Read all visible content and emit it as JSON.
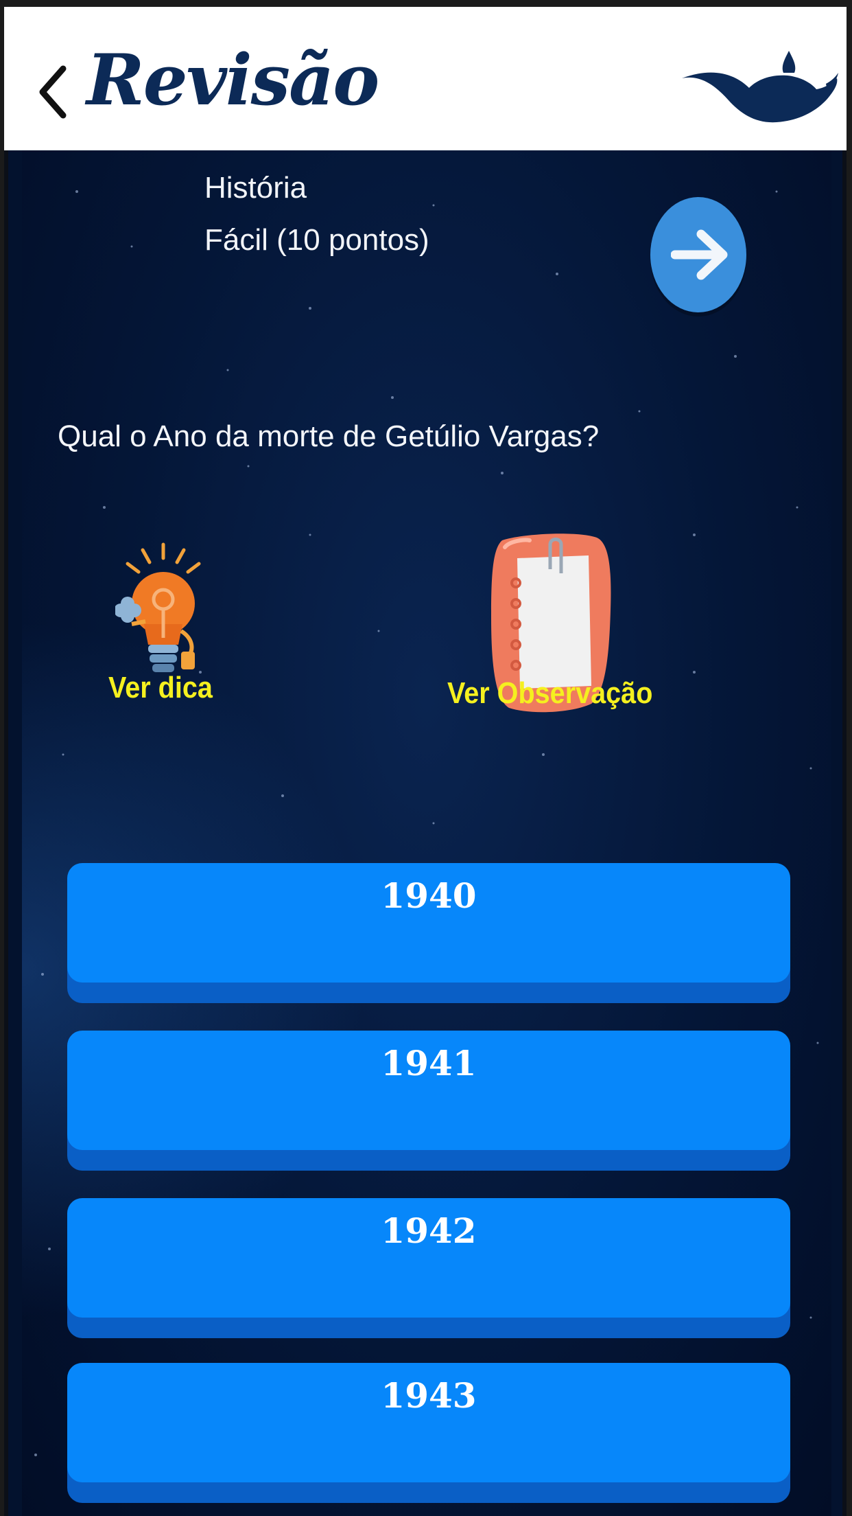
{
  "header": {
    "title": "Revisão",
    "back_icon": "chevron-left-icon",
    "logo_icon": "magic-lamp-logo"
  },
  "quiz": {
    "subject": "História",
    "difficulty": "Fácil (10 pontos)",
    "next_icon": "arrow-right-icon",
    "question": "Qual o Ano da morte de Getúlio Vargas?"
  },
  "actions": {
    "hint_label": "Ver dica",
    "hint_icon": "lightbulb-icon",
    "observation_label": "Ver Observação",
    "observation_icon": "notepad-icon"
  },
  "answers": [
    {
      "label": "1940"
    },
    {
      "label": "1941"
    },
    {
      "label": "1942"
    },
    {
      "label": "1943"
    }
  ],
  "colors": {
    "header_bg": "#ffffff",
    "brand_navy": "#0c2a57",
    "background": "#03122e",
    "answer_button": "#0787fa",
    "action_label": "#f5f01f",
    "next_button": "#3a8fdc"
  }
}
